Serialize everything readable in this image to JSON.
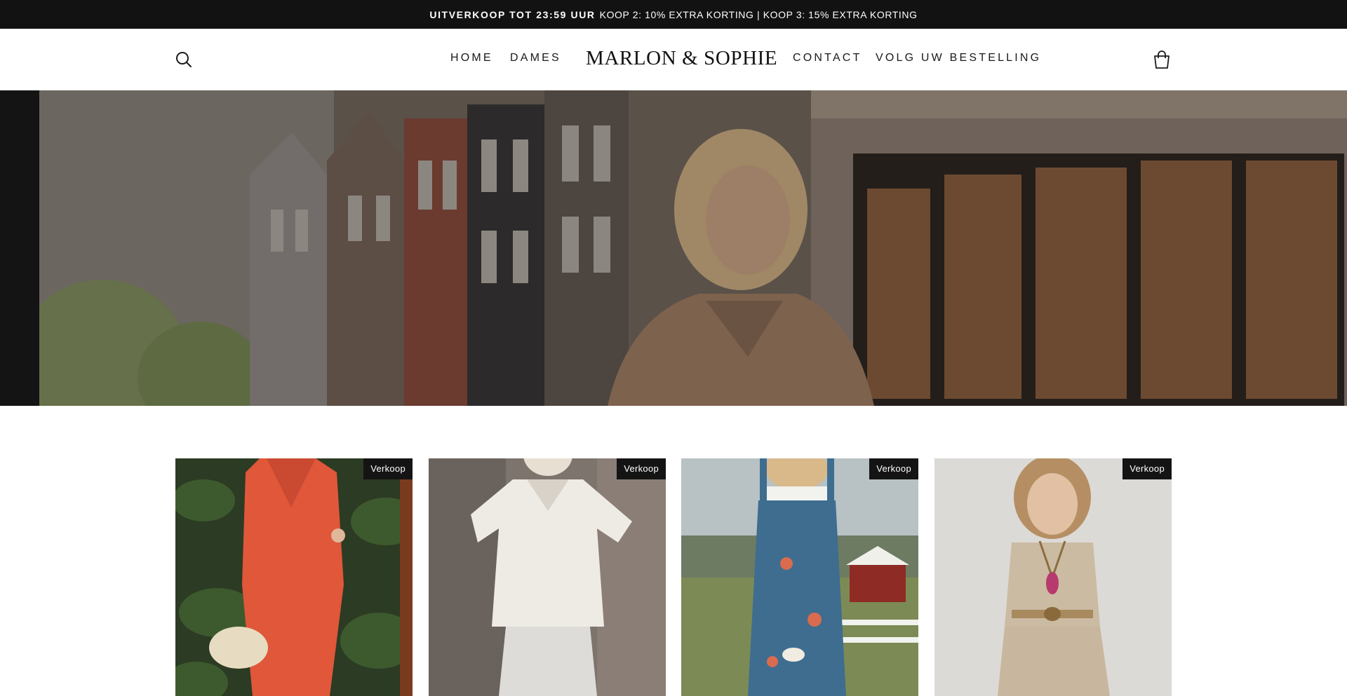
{
  "announcement": {
    "highlight": "UITVERKOOP TOT 23:59 UUR",
    "text": "KOOP 2: 10% EXTRA KORTING | KOOP 3: 15% EXTRA KORTING"
  },
  "header": {
    "logo": "MARLON & SOPHIE",
    "nav": {
      "home": "HOME",
      "dames": "DAMES",
      "contact": "CONTACT",
      "track": "VOLG UW BESTELLING"
    },
    "icons": {
      "search": "search-icon",
      "cart": "shopping-bag-icon"
    }
  },
  "products": [
    {
      "badge": "Verkoop"
    },
    {
      "badge": "Verkoop"
    },
    {
      "badge": "Verkoop"
    },
    {
      "badge": "Verkoop"
    }
  ],
  "colors": {
    "announcement_bg": "#121212",
    "badge_bg": "#141414",
    "text": "#111111"
  }
}
